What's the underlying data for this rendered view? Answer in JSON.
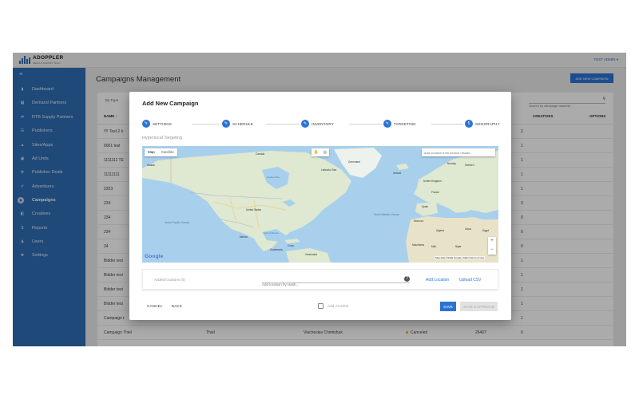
{
  "app": {
    "brand": "ADOPPLER",
    "tagline": "MEDIA & MARKET TECH",
    "user_label": "TEST ADMIN"
  },
  "sidebar": {
    "items": [
      {
        "label": "Dashboard",
        "icon": "bar-chart-icon"
      },
      {
        "label": "Demand Partners",
        "icon": "grid-icon"
      },
      {
        "label": "RTB Supply Partners",
        "icon": "transfer-icon"
      },
      {
        "label": "Publishers",
        "icon": "list-icon"
      },
      {
        "label": "Sites/Apps",
        "icon": "triangle-icon"
      },
      {
        "label": "Ad Units",
        "icon": "ad-icon"
      },
      {
        "label": "Publisher Deals",
        "icon": "handshake-icon"
      },
      {
        "label": "Advertisers",
        "icon": "pin-icon"
      },
      {
        "label": "Campaigns",
        "icon": "campaign-icon",
        "active": true
      },
      {
        "label": "Creatives",
        "icon": "image-icon"
      },
      {
        "label": "Reports",
        "icon": "money-icon"
      },
      {
        "label": "Users",
        "icon": "users-icon"
      },
      {
        "label": "Settings",
        "icon": "gear-icon"
      }
    ]
  },
  "page": {
    "title": "Campaigns Management",
    "add_button": "ADD NEW CAMPAIGN"
  },
  "filters": {
    "by_type": "By Type",
    "search_placeholder": "Search by campaign name/id"
  },
  "table": {
    "headers": {
      "name": "NAME ↑",
      "creatives": "CREATIVES",
      "options": "OPTIONS"
    },
    "rows": [
      {
        "name": "!!!! Test 2 b",
        "creatives": "2"
      },
      {
        "name": "0001 test",
        "creatives": "1"
      },
      {
        "name": "1111111 TE",
        "creatives": "1"
      },
      {
        "name": "11111111",
        "creatives": "1"
      },
      {
        "name": "2323",
        "creatives": "1"
      },
      {
        "name": "234",
        "creatives": "3"
      },
      {
        "name": "234",
        "creatives": "0"
      },
      {
        "name": "234",
        "creatives": "0"
      },
      {
        "name": "34",
        "creatives": "0"
      },
      {
        "name": "Bidder test",
        "creatives": "1"
      },
      {
        "name": "Bidder test",
        "creatives": "1"
      },
      {
        "name": "Bidder test",
        "creatives": "1"
      },
      {
        "name": "Bidder test",
        "creatives": "1"
      },
      {
        "name": "Campaign t",
        "creatives": "1"
      },
      {
        "name": "Campaign Thiel",
        "advertiser": "Thiel",
        "owner": "Viacheslav Chimishuk",
        "status": "Canceled",
        "id": "26407",
        "creatives": "0"
      }
    ]
  },
  "modal": {
    "title": "Add New Campaign",
    "steps": [
      {
        "label": "SETTINGS",
        "marker": "✎"
      },
      {
        "label": "SCHEDULE",
        "marker": "✎"
      },
      {
        "label": "INVENTORY",
        "marker": "✎"
      },
      {
        "label": "TARGETING",
        "marker": "✎"
      },
      {
        "label": "GEOGRAPHY",
        "marker": "5"
      }
    ],
    "section_title": "Hyperlocal Targeting",
    "map": {
      "tab_map": "Map",
      "tab_satellite": "Satellite",
      "search_placeholder": "Add location from search results...",
      "zoom_in": "+",
      "zoom_out": "−",
      "credit": "Map data ©2020 Google, INEGI   Terms of Use",
      "google": "Google",
      "oceans": {
        "north_pacific": "North Pacific Ocean",
        "north_atlantic": "North Atlantic Ocean",
        "gulf": "Gulf of Mexico",
        "hudson": "Hudson Bay"
      },
      "places": {
        "canada": "Canada",
        "united_states": "United States",
        "mexico": "Mexico",
        "cuba": "Cuba",
        "venezuela": "Venezuela",
        "guatemala": "Guatemala",
        "greenland": "Greenland",
        "iceland": "Iceland",
        "united_kingdom": "United Kingdom",
        "france": "France",
        "spain": "Spain",
        "morocco": "Morocco",
        "algeria": "Algeria",
        "libya": "Libya",
        "egypt": "Egypt",
        "mali": "Mali",
        "niger": "Niger",
        "mauritania": "Mauritania",
        "sweden": "Sweden",
        "norway": "Norway",
        "alaska": "Alaska",
        "labrador_sea": "Labrador Sea"
      }
    },
    "added_locations": "Added locations (0)",
    "hash_placeholder": "Add location by Hash...",
    "add_location": "Add Location",
    "upload_csv": "Upload CSV",
    "footer": {
      "cancel": "CANCEL",
      "back": "BACK",
      "add_another": "Add Another",
      "save": "SAVE",
      "save_approve": "SAVE & APPROVE"
    }
  },
  "colors": {
    "sidebar": "#2f6eb4",
    "primary": "#2a73d6",
    "status_canceled": "#f0a030",
    "water": "#a8d0ec",
    "land": "#dfe8d0"
  }
}
